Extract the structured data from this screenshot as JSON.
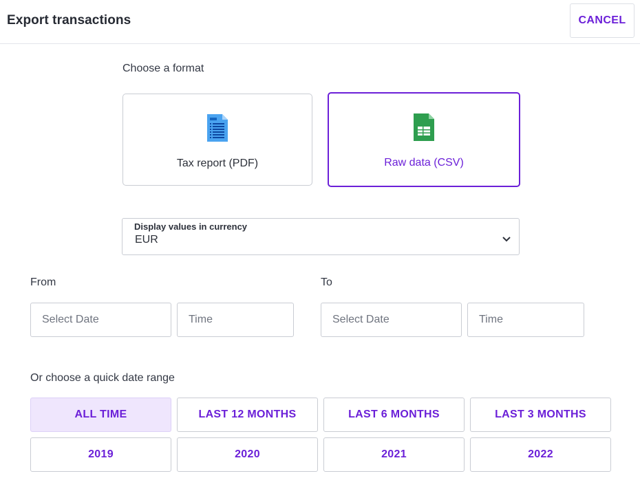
{
  "header": {
    "title": "Export transactions",
    "cancel_label": "CANCEL"
  },
  "format": {
    "heading": "Choose a format",
    "options": [
      {
        "label": "Tax report (PDF)",
        "icon": "pdf-document-icon",
        "selected": false
      },
      {
        "label": "Raw data (CSV)",
        "icon": "spreadsheet-icon",
        "selected": true
      }
    ]
  },
  "currency": {
    "label": "Display values in currency",
    "value": "EUR",
    "icon": "chevron-down-icon"
  },
  "from": {
    "label": "From",
    "date_placeholder": "Select Date",
    "time_placeholder": "Time"
  },
  "to": {
    "label": "To",
    "date_placeholder": "Select Date",
    "time_placeholder": "Time"
  },
  "quick_range": {
    "heading": "Or choose a quick date range",
    "options": [
      "ALL TIME",
      "LAST 12 MONTHS",
      "LAST 6 MONTHS",
      "LAST 3 MONTHS",
      "2019",
      "2020",
      "2021",
      "2022"
    ],
    "active": "ALL TIME"
  },
  "colors": {
    "accent": "#6b1fd8",
    "active_range_bg": "#efe6fd",
    "pdf_icon": "#4aa3f0",
    "csv_icon": "#2e9e4f"
  }
}
